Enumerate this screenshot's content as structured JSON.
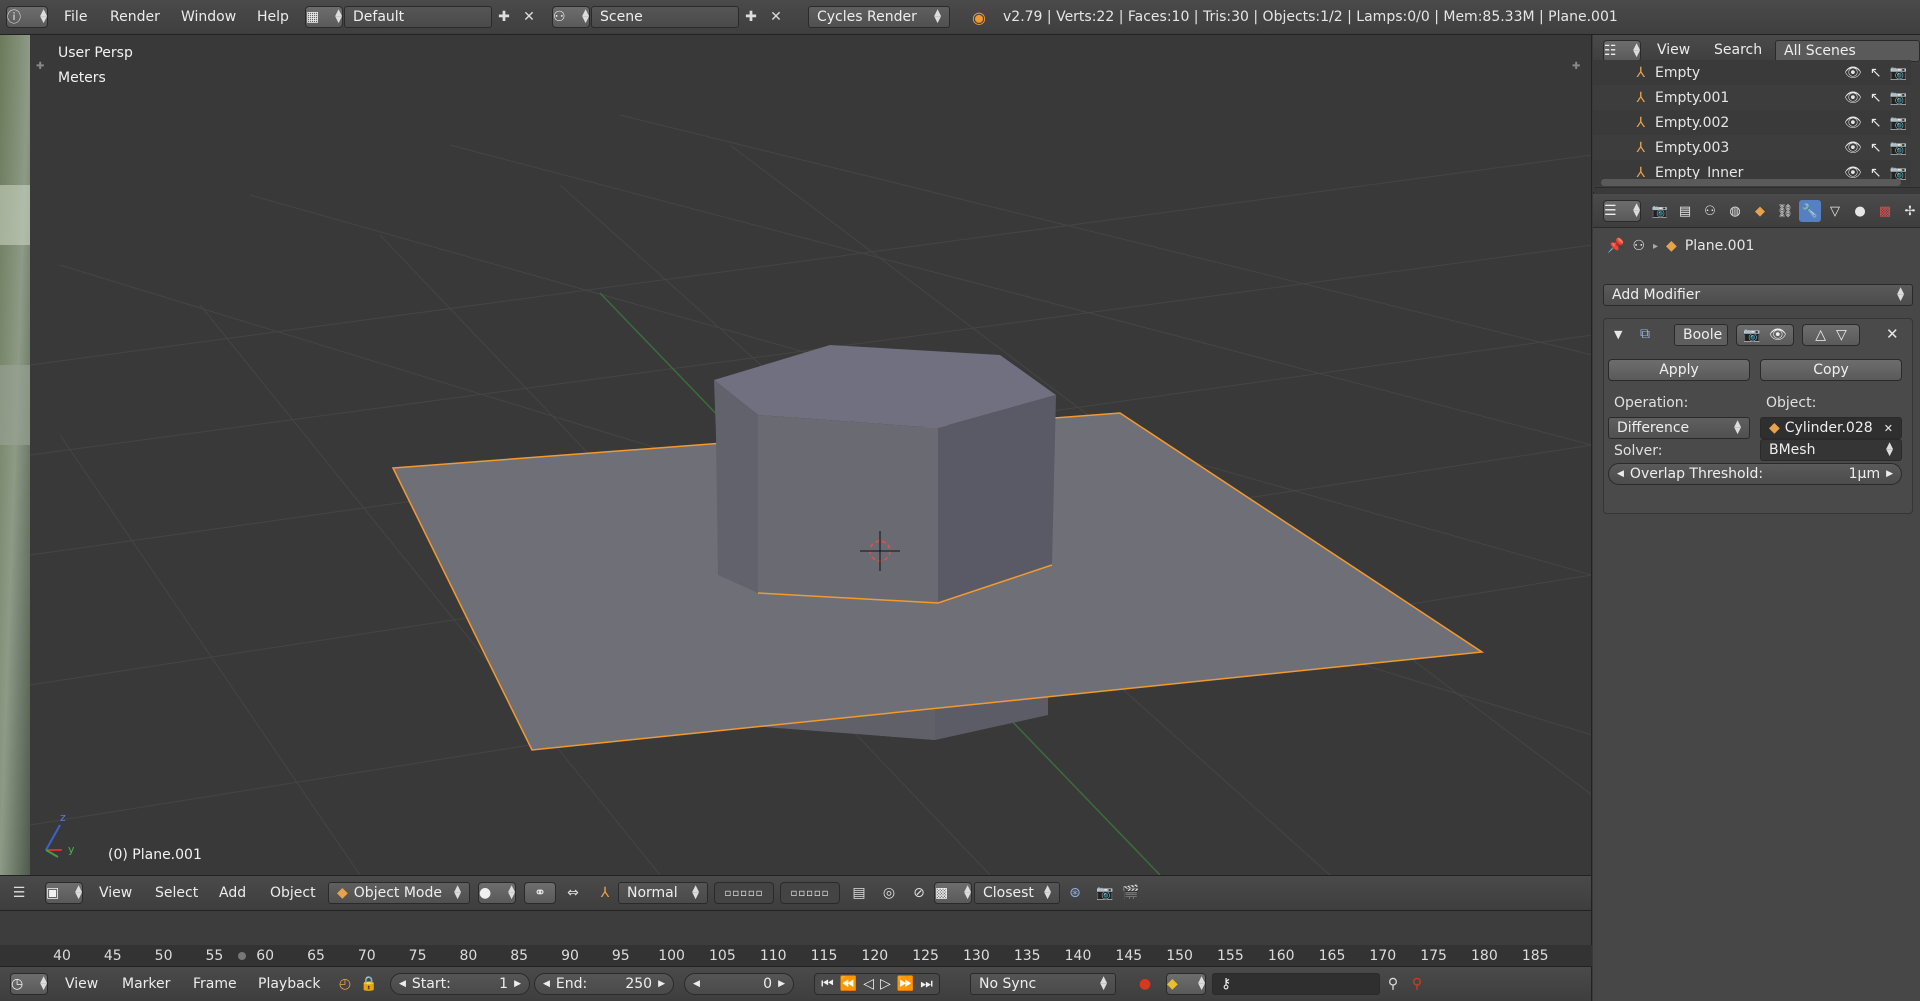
{
  "topbar": {
    "menus": [
      "File",
      "Render",
      "Window",
      "Help"
    ],
    "screen_layout": "Default",
    "scene": "Scene",
    "render_engine": "Cycles Render",
    "stats": "v2.79 | Verts:22 | Faces:10 | Tris:30 | Objects:1/2 | Lamps:0/0 | Mem:85.33M | Plane.001"
  },
  "viewport": {
    "view_label": "User Persp",
    "units_label": "Meters",
    "active_object_label": "(0) Plane.001",
    "axis_labels": {
      "z": "z",
      "y": "y"
    }
  },
  "viewport_header": {
    "menus": [
      "View",
      "Select",
      "Add",
      "Object"
    ],
    "mode": "Object Mode",
    "orientation": "Normal",
    "snap_target": "Closest"
  },
  "timeline": {
    "ticks": [
      "40",
      "45",
      "50",
      "55",
      "60",
      "65",
      "70",
      "75",
      "80",
      "85",
      "90",
      "95",
      "100",
      "105",
      "110",
      "115",
      "120",
      "125",
      "130",
      "135",
      "140",
      "145",
      "150",
      "155",
      "160",
      "165",
      "170",
      "175",
      "180",
      "185"
    ]
  },
  "timeline_header": {
    "menus": [
      "View",
      "Marker",
      "Frame",
      "Playback"
    ],
    "start_label": "Start:",
    "start_value": "1",
    "end_label": "End:",
    "end_value": "250",
    "current_frame": "0",
    "sync": "No Sync"
  },
  "outliner": {
    "menus": [
      "View",
      "Search"
    ],
    "filter": "All Scenes",
    "items": [
      "Empty",
      "Empty.001",
      "Empty.002",
      "Empty.003",
      "Empty_Inner"
    ]
  },
  "properties": {
    "context_object": "Plane.001",
    "add_modifier_label": "Add Modifier",
    "modifier": {
      "name": "Boole",
      "apply_label": "Apply",
      "copy_label": "Copy",
      "operation_label": "Operation:",
      "operation_value": "Difference",
      "object_label": "Object:",
      "object_value": "Cylinder.028",
      "solver_label": "Solver:",
      "solver_value": "BMesh",
      "overlap_label": "Overlap Threshold:",
      "overlap_value": "1µm"
    }
  },
  "colors": {
    "selection_outline": "#f29a2e",
    "active_tab": "#5680c2",
    "record_button": "#d9381e"
  }
}
